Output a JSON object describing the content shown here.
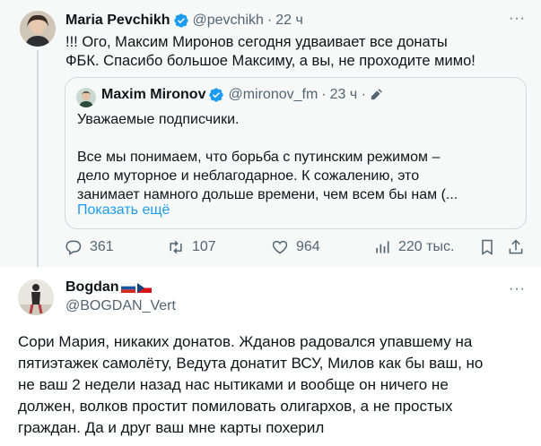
{
  "original_tweet": {
    "author": {
      "name": "Maria Pevchikh",
      "handle": "@pevchikh",
      "separator": "·",
      "time": "22 ч"
    },
    "text_lines": [
      "!!! Ого, Максим Миронов сегодня удваивает все донаты",
      "ФБК. Спасибо большое Максиму, а вы, не проходите мимо!"
    ],
    "quote": {
      "author": {
        "name": "Maxim Mironov",
        "handle": "@mironov_fm",
        "separator": "·",
        "time": "23 ч ·"
      },
      "text_lines": [
        "Уважаемые подписчики.",
        "",
        "Все мы понимаем, что борьба с путинским режимом –",
        "дело муторное и неблагодарное. К сожалению, это",
        "занимает намного дольше времени, чем всем бы нам (..."
      ],
      "show_more": "Показать ещё"
    },
    "actions": {
      "replies": "361",
      "reposts": "107",
      "likes": "964",
      "views": "220 тыс."
    }
  },
  "reply_tweet": {
    "author": {
      "name": "Bogdan",
      "handle": "@BOGDAN_Vert"
    },
    "text_lines": [
      "Сори Мария, никаких донатов. Жданов радовался упавшему на",
      "пятиэтажек самолёту, Ведута донатит ВСУ, Милов как бы ваш, но",
      "не ваш 2 недели назад нас нытиками и вообще он ничего не",
      "должен, волков простит помиловать олигархов, а не простых",
      "граждан. Да и друг ваш мне карты похерил"
    ]
  },
  "more_label": "···",
  "colors": {
    "verified": "#1d9bf0",
    "muted": "#536471",
    "link": "#1d9bf0",
    "card_bg": "#f7f9f9"
  },
  "icons": [
    "verified-icon",
    "reply-icon",
    "repost-icon",
    "like-icon",
    "views-icon",
    "bookmark-icon",
    "share-icon",
    "pencil-icon",
    "flag-russia-icon",
    "flag-czech-icon"
  ]
}
